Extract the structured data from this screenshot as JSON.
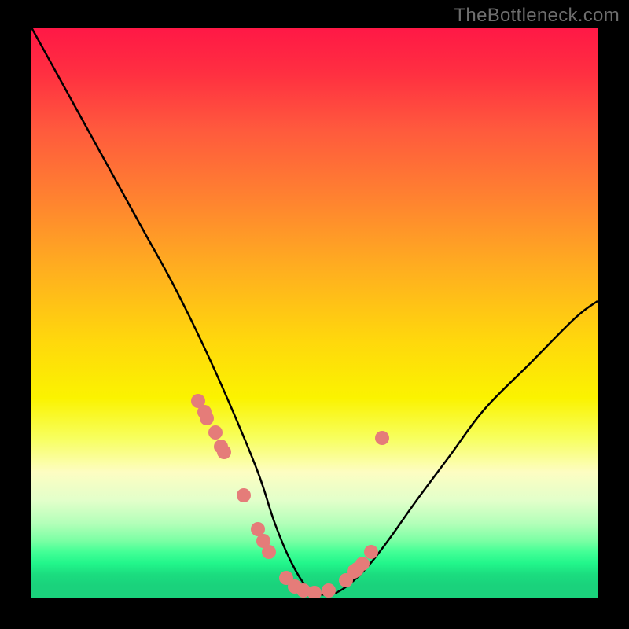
{
  "watermark": "TheBottleneck.com",
  "chart_data": {
    "type": "line",
    "title": "",
    "xlabel": "",
    "ylabel": "",
    "xlim": [
      0,
      100
    ],
    "ylim": [
      0,
      100
    ],
    "grid": false,
    "legend": null,
    "series": [
      {
        "name": "bottleneck-curve",
        "x": [
          0,
          5,
          10,
          15,
          20,
          25,
          30,
          35,
          40,
          43,
          46,
          49,
          52,
          55,
          59,
          63,
          68,
          74,
          80,
          88,
          96,
          100
        ],
        "values": [
          100,
          91,
          82,
          73,
          64,
          55,
          45,
          34,
          22,
          13,
          6,
          1.5,
          0.5,
          1.5,
          5,
          10,
          17,
          25,
          33,
          41,
          49,
          52
        ]
      }
    ],
    "scatter_points": {
      "name": "markers",
      "x": [
        29.5,
        30.5,
        31.0,
        32.5,
        33.5,
        34.0,
        37.5,
        40.0,
        41.0,
        42.0,
        45.0,
        46.5,
        48.0,
        50.0,
        52.5,
        55.5,
        57.0,
        57.5,
        58.5,
        60.0,
        62.0
      ],
      "y": [
        34.5,
        32.5,
        31.5,
        29.0,
        26.5,
        25.5,
        18.0,
        12.0,
        10.0,
        8.0,
        3.5,
        2.0,
        1.2,
        0.8,
        1.2,
        3.0,
        4.5,
        5.0,
        6.0,
        8.0,
        28.0
      ]
    },
    "background_gradient": {
      "direction": "vertical",
      "stops": [
        {
          "pos": 0.0,
          "color": "#ff1846"
        },
        {
          "pos": 0.65,
          "color": "#fbf300"
        },
        {
          "pos": 0.8,
          "color": "#fdfdc2"
        },
        {
          "pos": 0.95,
          "color": "#22f68b"
        },
        {
          "pos": 1.0,
          "color": "#1ad27c"
        }
      ]
    }
  }
}
